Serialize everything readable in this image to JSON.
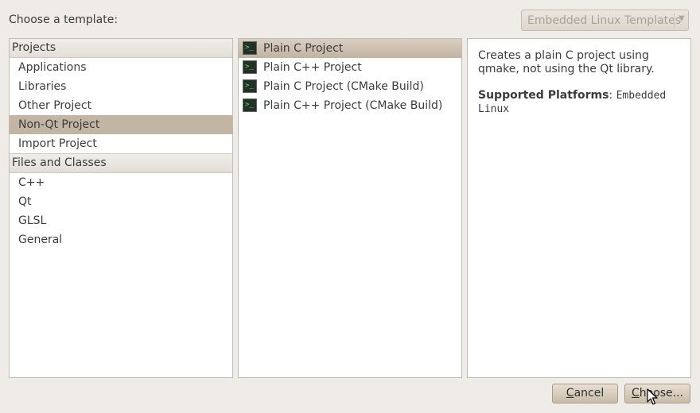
{
  "header": {
    "label": "Choose a template:",
    "combo_value": "Embedded Linux Templates",
    "combo_arrow": "▼"
  },
  "categories": {
    "groups": [
      {
        "title": "Projects",
        "items": [
          {
            "label": "Applications",
            "selected": false
          },
          {
            "label": "Libraries",
            "selected": false
          },
          {
            "label": "Other Project",
            "selected": false
          },
          {
            "label": "Non-Qt Project",
            "selected": true
          },
          {
            "label": "Import Project",
            "selected": false
          }
        ]
      },
      {
        "title": "Files and Classes",
        "items": [
          {
            "label": "C++",
            "selected": false
          },
          {
            "label": "Qt",
            "selected": false
          },
          {
            "label": "GLSL",
            "selected": false
          },
          {
            "label": "General",
            "selected": false
          }
        ]
      }
    ]
  },
  "templates": {
    "icon_glyph": ">_",
    "items": [
      {
        "label": "Plain C Project",
        "selected": true
      },
      {
        "label": "Plain C++ Project",
        "selected": false
      },
      {
        "label": "Plain C Project (CMake Build)",
        "selected": false
      },
      {
        "label": "Plain C++ Project (CMake Build)",
        "selected": false
      }
    ]
  },
  "description": {
    "text": "Creates a plain C project using qmake, not using the Qt library.",
    "platforms_label": "Supported Platforms",
    "platforms_sep": ": ",
    "platforms_value": "Embedded Linux"
  },
  "buttons": {
    "cancel_mnemonic": "C",
    "cancel_rest": "ancel",
    "choose_mnemonic": "C",
    "choose_rest": "hoose..."
  },
  "colors": {
    "selected_category": "#c3b5a3",
    "terminal_icon_bg": "#233129",
    "terminal_icon_fg": "#6be06b"
  }
}
